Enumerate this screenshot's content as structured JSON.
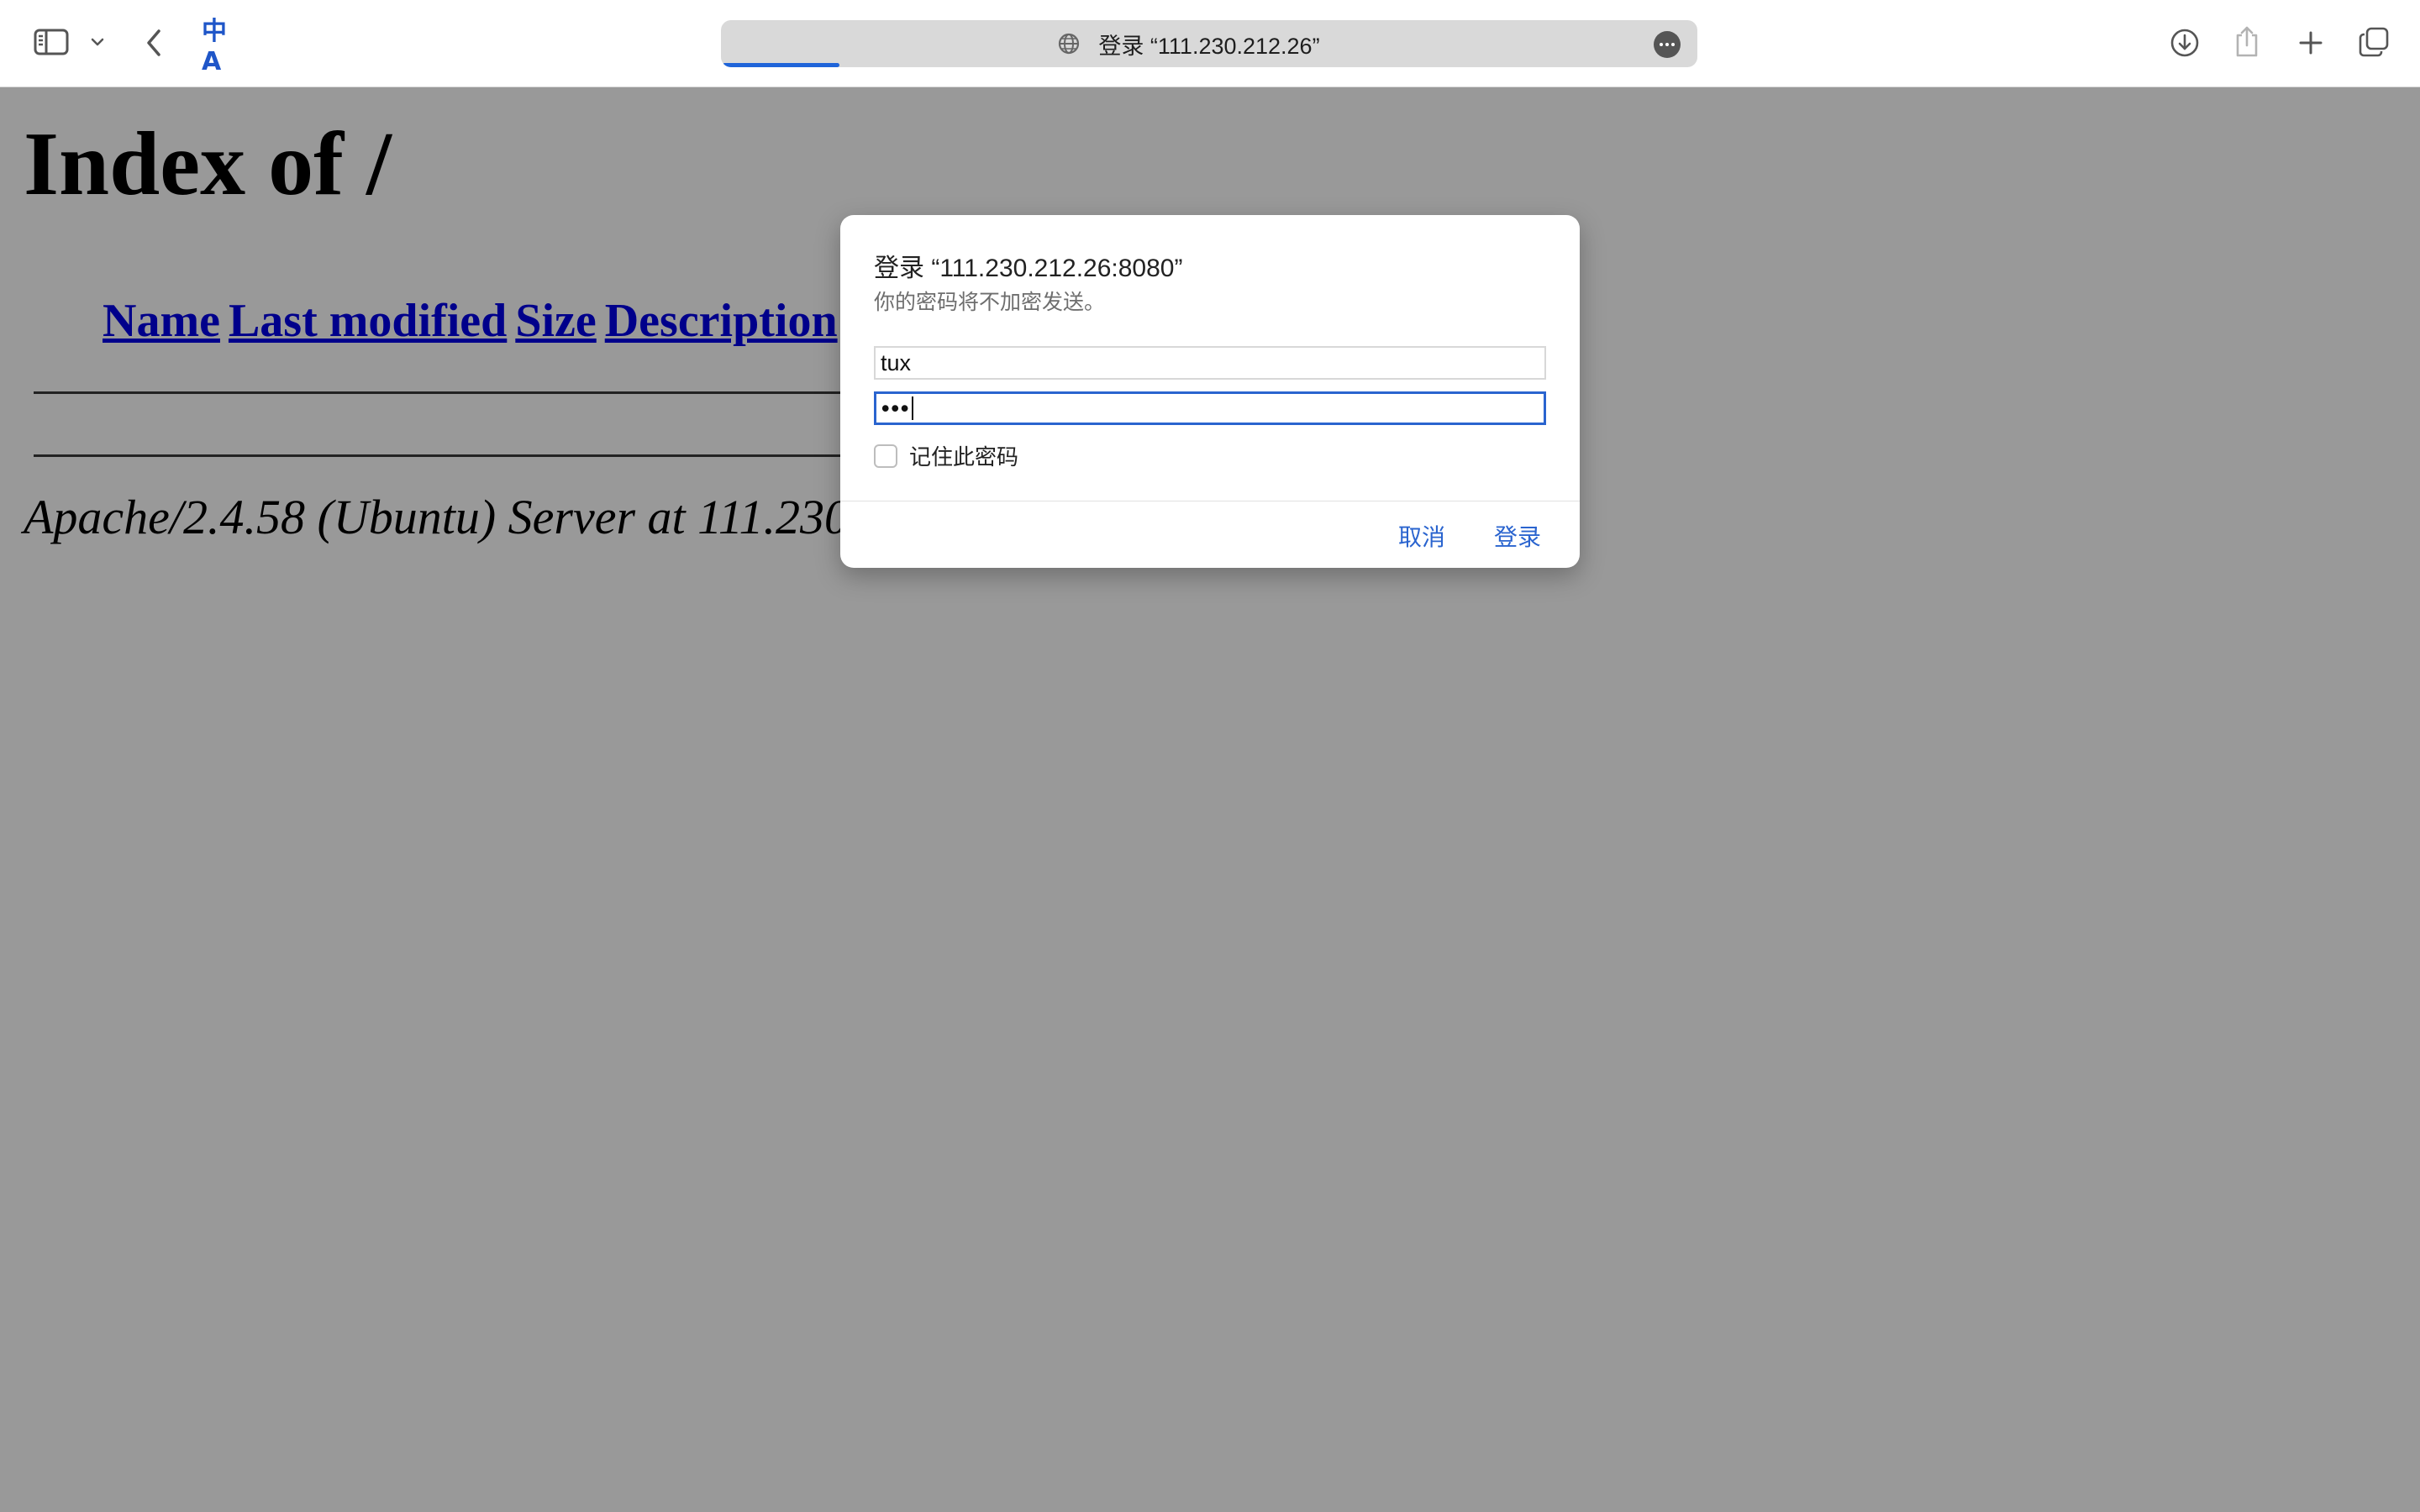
{
  "toolbar": {
    "address_text": "登录 “111.230.212.26”",
    "translate_glyph": "中A",
    "icons": [
      "sidebar-icon",
      "chevron-down-icon",
      "back-icon",
      "translate-icon",
      "globe-icon",
      "more-icon",
      "download-icon",
      "share-icon",
      "plus-icon",
      "tabs-icon"
    ],
    "accent_color": "#1f64d9",
    "load_progress": 0.12
  },
  "page": {
    "title": "Index of /",
    "columns": [
      "Name",
      "Last modified",
      "Size",
      "Description"
    ],
    "server_signature": "Apache/2.4.58 (Ubuntu) Server at 111.230.2"
  },
  "dialog": {
    "title": "登录 “111.230.212.26:8080”",
    "subtitle": "你的密码将不加密发送。",
    "username_value": "tux",
    "password_dots": "•••",
    "remember_label": "记住此密码",
    "remember_checked": false,
    "cancel_label": "取消",
    "login_label": "登录",
    "link_color": "#2a64cf"
  }
}
